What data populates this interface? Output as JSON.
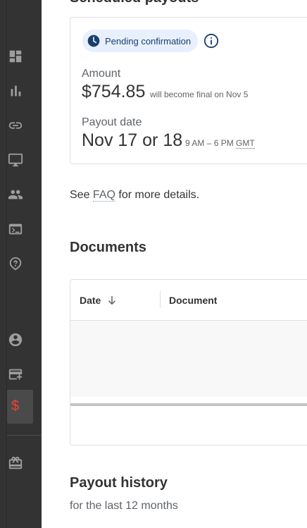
{
  "sidebar": {
    "items": [
      {
        "icon": "dashboard-icon"
      },
      {
        "icon": "bar-chart-icon"
      },
      {
        "icon": "link-icon"
      },
      {
        "icon": "monitor-icon"
      },
      {
        "icon": "people-icon"
      },
      {
        "icon": "terminal-icon"
      },
      {
        "icon": "help-icon"
      },
      {
        "icon": "account-circle-icon"
      },
      {
        "icon": "add-card-icon"
      },
      {
        "icon": "dollar-icon",
        "active": true,
        "label": "$"
      },
      {
        "icon": "gift-icon"
      }
    ],
    "colors": {
      "background": "#333333",
      "active_accent": "#ea4335"
    }
  },
  "scheduled_payout": {
    "status_chip": "Pending confirmation",
    "amount_label": "Amount",
    "amount_value": "$754.85",
    "amount_note": "will become final on Nov 5",
    "date_label": "Payout date",
    "date_value": "Nov 17 or 18",
    "date_note_time": "9 AM – 6 PM",
    "date_note_tz": "GMT"
  },
  "faq": {
    "prefix": "See ",
    "link": "FAQ",
    "suffix": " for more details."
  },
  "documents": {
    "title": "Documents",
    "columns": [
      "Date",
      "Document"
    ]
  },
  "payout_history": {
    "title": "Payout history",
    "subtitle": "for the last 12 months"
  }
}
